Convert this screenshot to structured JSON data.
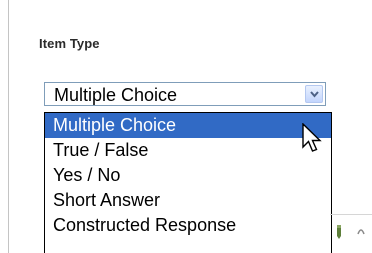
{
  "item_type": {
    "label": "Item Type",
    "selected_value": "Multiple Choice",
    "options": [
      "Multiple Choice",
      "True / False",
      "Yes / No",
      "Short Answer",
      "Constructed Response"
    ],
    "highlighted_index": 0
  },
  "colors": {
    "highlight": "#316ac5",
    "border": "#7f9db9"
  },
  "icons": [
    "chevron-down-icon",
    "mouse-pointer-icon"
  ]
}
